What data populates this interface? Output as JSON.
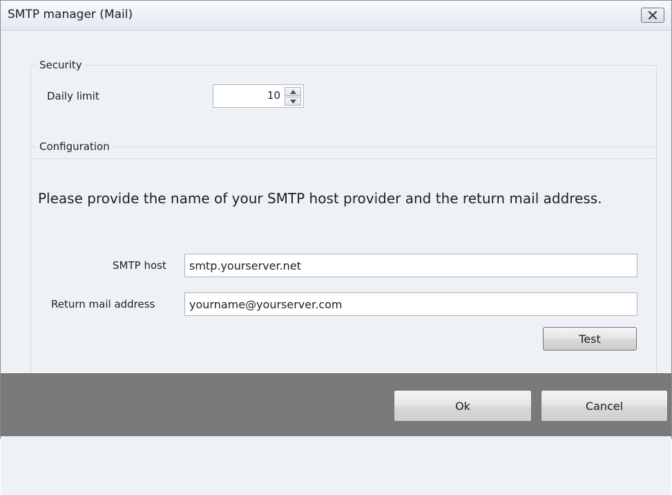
{
  "window": {
    "title": "SMTP manager (Mail)"
  },
  "security": {
    "legend": "Security",
    "daily_limit_label": "Daily limit",
    "daily_limit_value": "10"
  },
  "configuration": {
    "legend": "Configuration",
    "description": "Please provide the name of your SMTP host provider and the return mail address.",
    "smtp_host_label": "SMTP host",
    "smtp_host_value": "smtp.yourserver.net",
    "return_mail_label": "Return mail address",
    "return_mail_value": "yourname@yourserver.com",
    "test_label": "Test"
  },
  "footer": {
    "ok_label": "Ok",
    "cancel_label": "Cancel"
  },
  "icons": {
    "close": "close-icon",
    "spin_up": "arrow-up-icon",
    "spin_down": "arrow-down-icon"
  }
}
